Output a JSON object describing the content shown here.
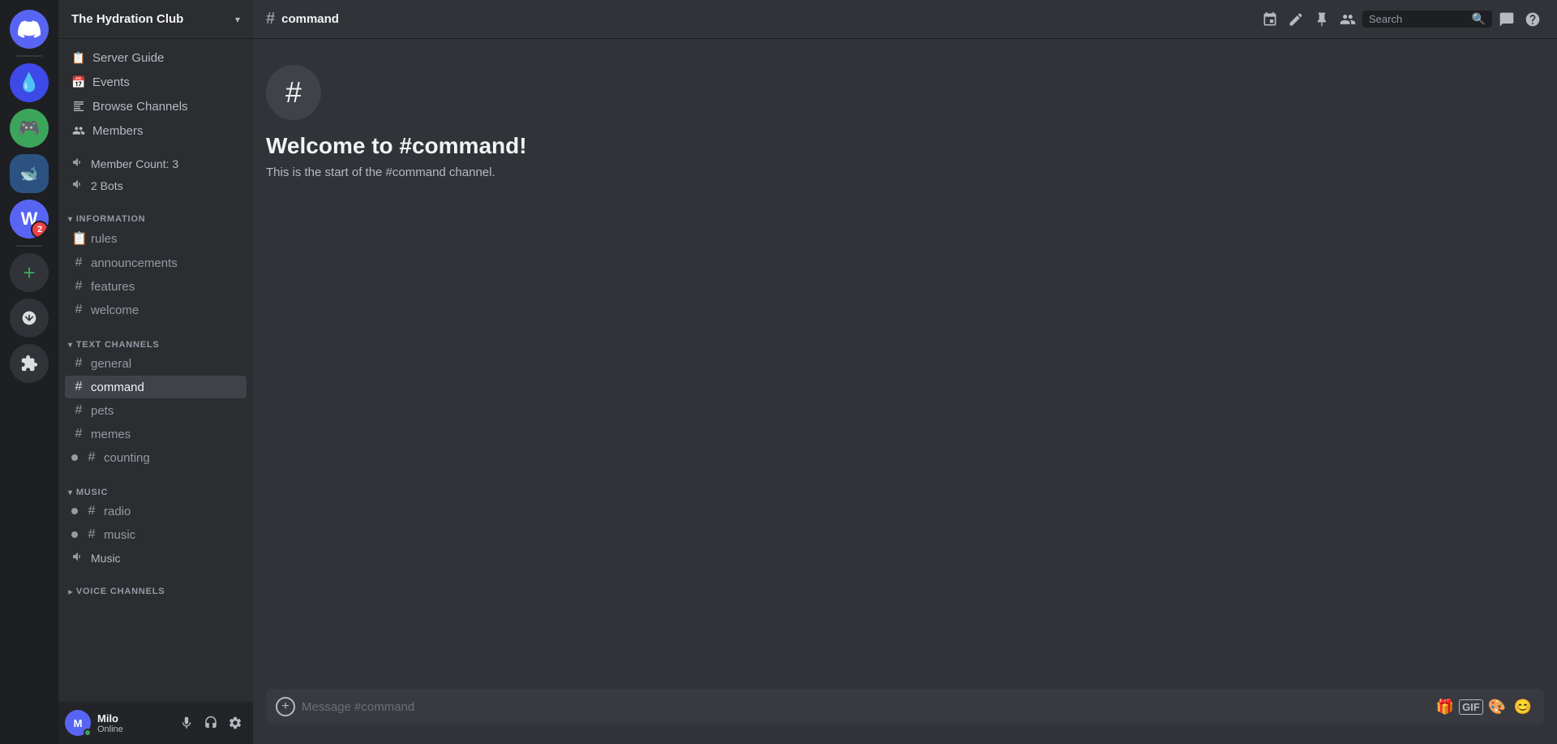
{
  "app": {
    "title": "Discord"
  },
  "server": {
    "name": "The Hydration Club",
    "chevron": "▾"
  },
  "sidebar_nav": [
    {
      "id": "server-guide",
      "icon": "📋",
      "label": "Server Guide"
    },
    {
      "id": "events",
      "icon": "📅",
      "label": "Events"
    },
    {
      "id": "browse-channels",
      "icon": "≡",
      "label": "Browse Channels"
    },
    {
      "id": "members",
      "icon": "👥",
      "label": "Members"
    }
  ],
  "voice_items": [
    {
      "id": "member-count",
      "icon": "🔊",
      "label": "Member Count: 3"
    },
    {
      "id": "bots",
      "icon": "🔊",
      "label": "2 Bots"
    }
  ],
  "channel_groups": [
    {
      "id": "information",
      "label": "INFORMATION",
      "expanded": true,
      "channels": [
        {
          "id": "rules",
          "type": "rules",
          "name": "rules"
        },
        {
          "id": "announcements",
          "type": "text",
          "name": "announcements"
        },
        {
          "id": "features",
          "type": "text",
          "name": "features"
        },
        {
          "id": "welcome",
          "type": "text",
          "name": "welcome"
        }
      ]
    },
    {
      "id": "text-channels",
      "label": "TEXT CHANNELS",
      "expanded": true,
      "channels": [
        {
          "id": "general",
          "type": "text",
          "name": "general"
        },
        {
          "id": "command",
          "type": "text",
          "name": "command",
          "active": true
        },
        {
          "id": "pets",
          "type": "text",
          "name": "pets"
        },
        {
          "id": "memes",
          "type": "text",
          "name": "memes"
        },
        {
          "id": "counting",
          "type": "text",
          "name": "counting",
          "bullet": true
        }
      ]
    },
    {
      "id": "music",
      "label": "MUSIC",
      "expanded": true,
      "channels": [
        {
          "id": "radio",
          "type": "text",
          "name": "radio",
          "bullet": true
        },
        {
          "id": "music",
          "type": "text",
          "name": "music",
          "bullet": true
        }
      ]
    },
    {
      "id": "voice-channels-voice",
      "label": "VOICE CHANNELS",
      "expanded": false,
      "channels": []
    }
  ],
  "music_voice": {
    "name": "Music",
    "icon": "🔊"
  },
  "active_channel": {
    "hash": "#",
    "name": "command"
  },
  "topbar": {
    "channel_name": "command",
    "search_placeholder": "Search",
    "icons": [
      {
        "id": "threads-icon",
        "symbol": "⊕"
      },
      {
        "id": "edit-icon",
        "symbol": "✏"
      },
      {
        "id": "pin-icon",
        "symbol": "📌"
      },
      {
        "id": "members-icon",
        "symbol": "👥"
      }
    ]
  },
  "welcome": {
    "icon": "#",
    "title": "Welcome to #command!",
    "description": "This is the start of the #command channel."
  },
  "message_input": {
    "placeholder": "Message #command"
  },
  "user": {
    "name": "Milo",
    "status": "Online",
    "avatar_text": "M"
  },
  "icons_bar": {
    "items": [
      {
        "id": "discord-logo",
        "type": "logo"
      },
      {
        "id": "avatar-1",
        "color": "#3d4ae7",
        "text": "💧"
      },
      {
        "id": "avatar-2",
        "color": "#3ba55c",
        "text": "🎮"
      },
      {
        "id": "avatar-3",
        "color": "#9b59b6",
        "text": "🐋"
      },
      {
        "id": "avatar-4-badge",
        "color": "#5865f2",
        "text": "W",
        "badge": "2"
      },
      {
        "id": "add",
        "type": "add"
      },
      {
        "id": "download",
        "type": "download"
      },
      {
        "id": "game",
        "type": "game"
      }
    ]
  }
}
